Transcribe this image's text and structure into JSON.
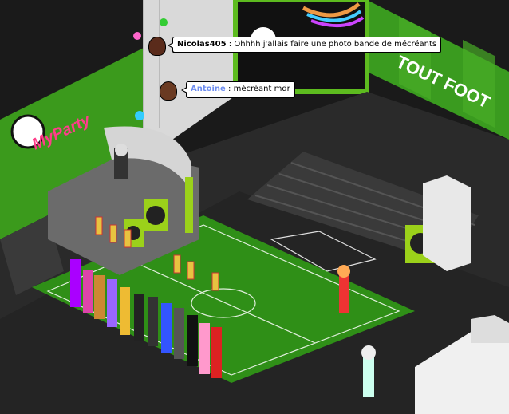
{
  "room": {
    "logo_text": "MyParty",
    "wall_sign": "TOUT FOOT",
    "colors": {
      "wall_green": "#3fa11e",
      "pitch_green": "#2f8f17",
      "floor": "#2b2b2b",
      "screen": "#111111"
    }
  },
  "chat": [
    {
      "user": "Nicolas405",
      "separator": " : ",
      "message": "Ohhhh j'allais faire une photo bande de mécréants",
      "name_color": "#000000"
    },
    {
      "user": "Antoine",
      "separator": " : ",
      "message": "mécréant mdr",
      "name_color": "#6f8ef0"
    }
  ]
}
